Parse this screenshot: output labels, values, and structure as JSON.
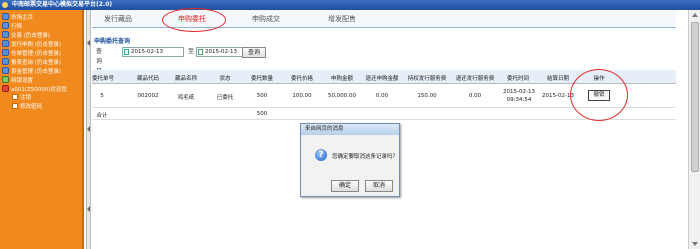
{
  "window": {
    "title": "中南邮票交易中心模拟交易平台(2.0)"
  },
  "sidebar": {
    "items": [
      {
        "label": "市场主页",
        "icon": "home-icon"
      },
      {
        "label": "行情",
        "icon": "chart-icon"
      },
      {
        "label": "交易 (仍击登录)",
        "icon": "trade-icon"
      },
      {
        "label": "发行申购 (仍击登录)",
        "icon": "subscribe-icon"
      },
      {
        "label": "仓单管理 (仍击登录)",
        "icon": "warehouse-icon"
      },
      {
        "label": "报表查询 (仍击登录)",
        "icon": "report-icon"
      },
      {
        "label": "资金管理 (仍击登录)",
        "icon": "money-icon"
      },
      {
        "label": "网银设置",
        "icon": "bank-icon"
      },
      {
        "label": "a001(ZS0000)欢迎您",
        "icon": "user-icon"
      }
    ],
    "sub_items": [
      {
        "label": "注销",
        "icon": "logout-icon"
      },
      {
        "label": "修改密码",
        "icon": "password-icon"
      }
    ]
  },
  "tabs": [
    {
      "label": "发行藏品"
    },
    {
      "label": "申购委托"
    },
    {
      "label": "申购成交"
    },
    {
      "label": "增发配售"
    }
  ],
  "query": {
    "title": "申购委托查询",
    "date_label": "查询日期:",
    "from_date": "2015-02-13",
    "to_label": "至",
    "to_date": "2015-02-13",
    "button": "查询"
  },
  "table": {
    "headers": [
      "委托单号",
      "藏品代码",
      "藏品名称",
      "状态",
      "委托数量",
      "委托价格",
      "申购金额",
      "退还申购金额",
      "持权发行服务费",
      "退还发行服务费",
      "委托时间",
      "结算日期",
      "操作"
    ],
    "rows": [
      [
        "5",
        "002002",
        "鸡毛纸",
        "已委托",
        "500",
        "100.00",
        "50,000.00",
        "0.00",
        "150.00",
        "0.00",
        "2015-02-13 09:34:54",
        "2015-02-13",
        "撤销"
      ]
    ],
    "total_label": "合计",
    "total_qty": "500"
  },
  "dialog": {
    "title": "来自网页的消息",
    "message": "您确定要取消这条记录吗？",
    "ok": "确定",
    "cancel": "取消"
  }
}
